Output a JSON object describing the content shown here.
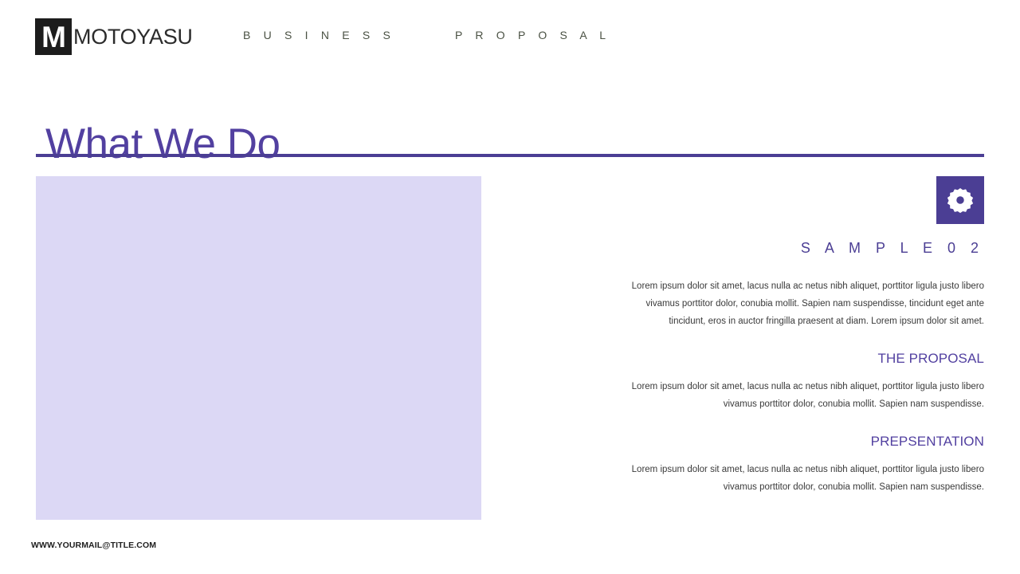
{
  "header": {
    "logo_letter": "M",
    "brand_name": "MOTOYASU",
    "nav": [
      {
        "label": "B U S I N E S S"
      },
      {
        "label": "P R O P O S A L"
      }
    ]
  },
  "slide": {
    "title": "What We Do",
    "media_alt": "image-placeholder"
  },
  "content": {
    "badge_icon": "gear-icon",
    "eyebrow": "S A M P L E   0 2",
    "intro_paragraph": "Lorem ipsum dolor sit amet, lacus nulla ac netus nibh aliquet, porttitor ligula justo libero vivamus porttitor dolor, conubia mollit. Sapien nam suspendisse, tincidunt eget ante tincidunt, eros in auctor fringilla praesent at diam. Lorem ipsum dolor sit amet.",
    "sections": [
      {
        "heading": "THE PROPOSAL",
        "paragraph": "Lorem ipsum dolor sit amet, lacus nulla ac netus nibh aliquet, porttitor ligula justo libero vivamus porttitor dolor, conubia mollit. Sapien nam suspendisse."
      },
      {
        "heading": "PREPSENTATION",
        "paragraph": "Lorem ipsum dolor sit amet, lacus nulla ac netus nibh aliquet, porttitor ligula justo libero vivamus porttitor dolor, conubia mollit. Sapien nam suspendisse."
      }
    ]
  },
  "footer": {
    "contact": "WWW.YOURMAIL@TITLE.COM"
  },
  "colors": {
    "accent_purple": "#4b3e94",
    "title_purple": "#5240a0",
    "placeholder_lavender": "#dcd8f5",
    "logo_dark": "#1c1c1c",
    "nav_text": "#4b5244",
    "body_text": "#3a3a3a"
  }
}
